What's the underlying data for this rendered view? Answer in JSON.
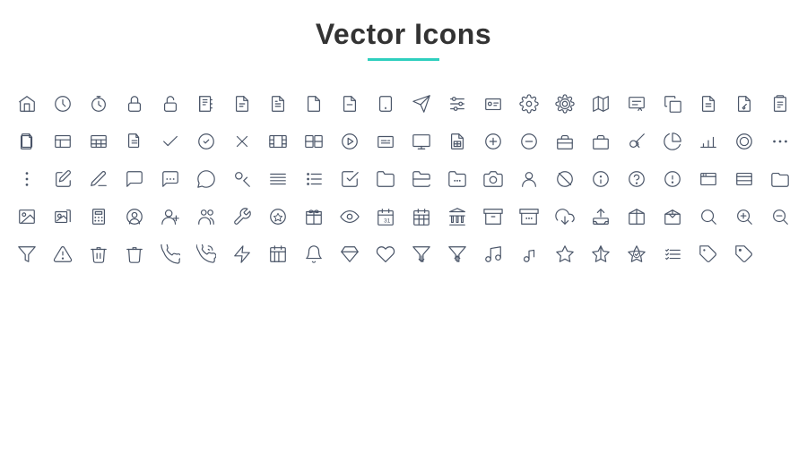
{
  "header": {
    "title": "Vector Icons",
    "accent_color": "#2ecfbe"
  },
  "icons": [
    {
      "name": "home-icon",
      "unicode": "🏠"
    },
    {
      "name": "clock-icon"
    },
    {
      "name": "timer-icon"
    },
    {
      "name": "lock-icon"
    },
    {
      "name": "lock-open-icon"
    },
    {
      "name": "notebook-icon"
    },
    {
      "name": "document-icon"
    },
    {
      "name": "file-text-icon"
    },
    {
      "name": "file-icon"
    },
    {
      "name": "file-minus-icon"
    },
    {
      "name": "tablet-icon"
    },
    {
      "name": "send-icon"
    },
    {
      "name": "sliders-icon"
    },
    {
      "name": "id-card-icon"
    },
    {
      "name": "settings-icon"
    },
    {
      "name": "settings2-icon"
    },
    {
      "name": "map-icon"
    },
    {
      "name": "certificate-icon"
    },
    {
      "name": "copy-icon"
    },
    {
      "name": "file-list-icon"
    },
    {
      "name": "file-edit-icon"
    },
    {
      "name": "clipboard-icon"
    }
  ]
}
